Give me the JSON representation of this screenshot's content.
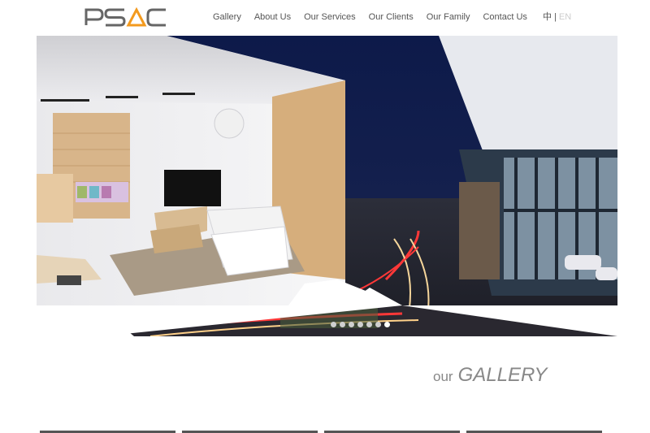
{
  "brand": {
    "logo_text": "PSAC",
    "accent": "#f39a1e",
    "logo_color": "#666666"
  },
  "nav": {
    "items": [
      {
        "label": "Gallery"
      },
      {
        "label": "About Us"
      },
      {
        "label": "Our Services"
      },
      {
        "label": "Our Clients"
      },
      {
        "label": "Our Family"
      },
      {
        "label": "Contact Us"
      }
    ]
  },
  "lang": {
    "zh": "中",
    "separator": "|",
    "en": "EN"
  },
  "hero": {
    "slide_count": 7,
    "active_slide": 7
  },
  "gallery": {
    "prefix": "our",
    "title": "GALLERY"
  }
}
